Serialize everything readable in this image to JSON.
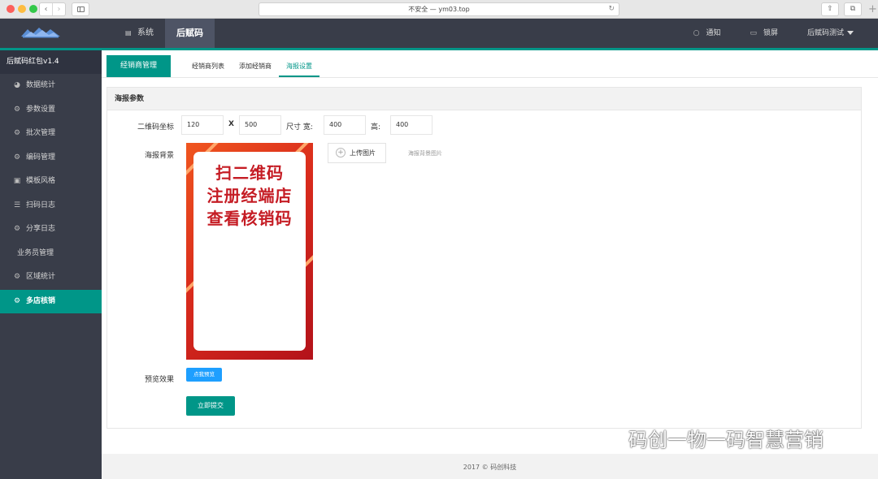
{
  "browser": {
    "url_text": "不安全 — ym03.top",
    "reload_glyph": "↻",
    "back_glyph": "‹",
    "forward_glyph": "›",
    "share_glyph": "⇧",
    "tabs_glyph": "⧉",
    "newtab_glyph": "+"
  },
  "header": {
    "menu": [
      {
        "label": "系统",
        "icon": "stack-icon",
        "icon_glyph": "▤"
      },
      {
        "label": "后赋码",
        "active": true
      }
    ],
    "right": [
      {
        "label": "通知",
        "icon": "bell-icon",
        "icon_glyph": "○"
      },
      {
        "label": "锁屏",
        "icon": "monitor-icon",
        "icon_glyph": "▭"
      },
      {
        "label": "后赋码测试"
      }
    ],
    "accent_color": "#009688"
  },
  "sidebar": {
    "title": "后赋码红包v1.4",
    "items": [
      {
        "label": "数据统计",
        "icon": "pie-chart-icon",
        "icon_glyph": "◕"
      },
      {
        "label": "参数设置",
        "icon": "gear-icon",
        "icon_glyph": "⚙"
      },
      {
        "label": "批次管理",
        "icon": "gear-icon",
        "icon_glyph": "⚙"
      },
      {
        "label": "编码管理",
        "icon": "gear-icon",
        "icon_glyph": "⚙"
      },
      {
        "label": "模板风格",
        "icon": "template-icon",
        "icon_glyph": "▣"
      },
      {
        "label": "扫码日志",
        "icon": "list-icon",
        "icon_glyph": "☰"
      },
      {
        "label": "分享日志",
        "icon": "gear-icon",
        "icon_glyph": "⚙"
      },
      {
        "label": "业务员管理",
        "icon": ""
      },
      {
        "label": "区域统计",
        "icon": "gear-icon",
        "icon_glyph": "⚙"
      },
      {
        "label": "多店核销",
        "icon": "gear-icon",
        "icon_glyph": "⚙",
        "active": true
      }
    ]
  },
  "subnav": {
    "primary": "经销商管理",
    "tabs": [
      {
        "label": "经销商列表"
      },
      {
        "label": "添加经销商"
      },
      {
        "label": "海报设置",
        "active": true
      }
    ]
  },
  "panel": {
    "title": "海报参数",
    "qr_label": "二维码坐标",
    "qr_x": "120",
    "x_sep": "X",
    "qr_y": "500",
    "size_label": "尺寸 宽:",
    "width": "400",
    "height_label": "高:",
    "height": "400",
    "bg_label": "海报背景",
    "poster_lines": [
      "扫二维码",
      "注册经端店",
      "查看核销码"
    ],
    "upload_plus": "+",
    "upload_label": "上传图片",
    "upload_hint": "海报背景图片",
    "preview_label": "预览效果",
    "preview_button": "点我预览",
    "submit_button": "立即提交"
  },
  "footer": {
    "text": "2017 © 码创科技"
  },
  "watermark": {
    "text": "码创一物一码智慧营销"
  }
}
